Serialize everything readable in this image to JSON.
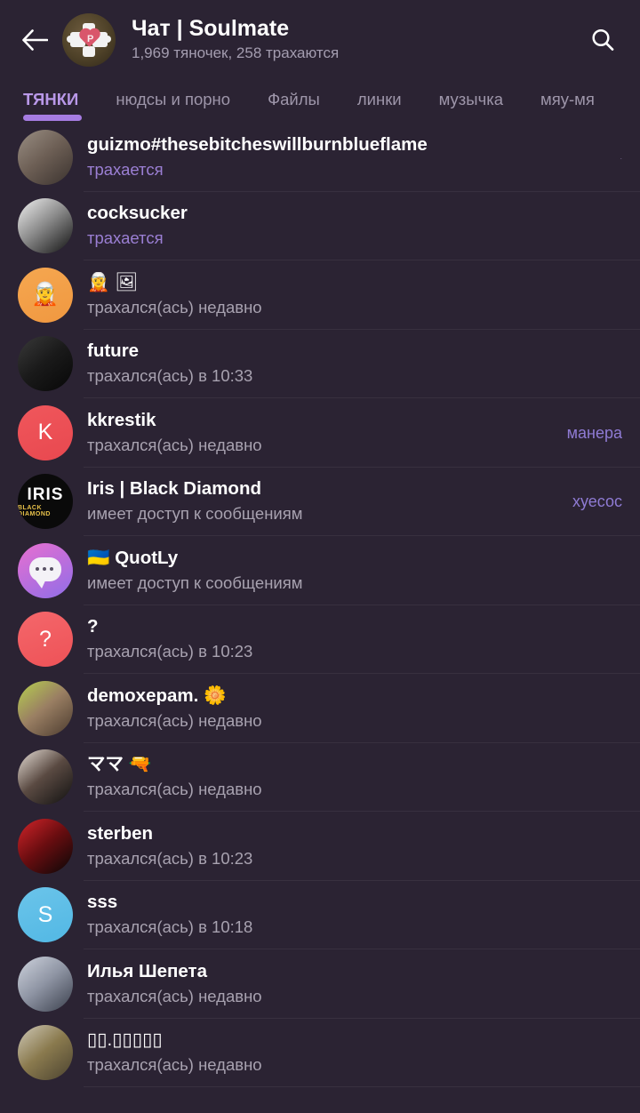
{
  "header": {
    "back_icon": "back-arrow-icon",
    "avatar_icon": "puzzle-heart-avatar",
    "avatar_letter": "P",
    "title": "Чат | Soulmate",
    "subtitle": "1,969 тяночек, 258 трахаются",
    "search_icon": "search-icon"
  },
  "tabs": {
    "items": [
      {
        "label": "ТЯНКИ",
        "active": true
      },
      {
        "label": "нюдсы и порно",
        "active": false
      },
      {
        "label": "Файлы",
        "active": false
      },
      {
        "label": "линки",
        "active": false
      },
      {
        "label": "музычка",
        "active": false
      },
      {
        "label": "мяу-мя",
        "active": false
      }
    ]
  },
  "members": [
    {
      "name": "guizmo#thesebitcheswillburnblueflame",
      "status": "трахается",
      "online": true,
      "badge": ".",
      "badge_tiny": true,
      "avatar_type": "photo",
      "avatar_colors": [
        "#9a8f84",
        "#6d5f55",
        "#3a322e"
      ],
      "avatar_label": ""
    },
    {
      "name": "cocksucker",
      "status": "трахается",
      "online": true,
      "badge": "",
      "avatar_type": "photo",
      "avatar_colors": [
        "#f2f2f2",
        "#8a8a8a",
        "#101010"
      ],
      "avatar_label": ""
    },
    {
      "name": "🧝 🖼",
      "status": "трахался(ась) недавно",
      "online": false,
      "badge": "",
      "avatar_type": "solid",
      "avatar_colors": [
        "#f5a750",
        "#f09840"
      ],
      "avatar_label": "🧝"
    },
    {
      "name": "future",
      "status": "трахался(ась) в 10:33",
      "online": false,
      "badge": "",
      "avatar_type": "photo",
      "avatar_colors": [
        "#3a3a3a",
        "#1a1a1a",
        "#070707"
      ],
      "avatar_label": ""
    },
    {
      "name": "kkrestik",
      "status": "трахался(ась) недавно",
      "online": false,
      "badge": "манера",
      "avatar_type": "solid",
      "avatar_colors": [
        "#f0575c",
        "#e8484f"
      ],
      "avatar_label": "K"
    },
    {
      "name": "Iris | Black Diamond",
      "status": "имеет доступ к сообщениям",
      "online": false,
      "badge": "хуесос",
      "avatar_type": "iris",
      "avatar_colors": [
        "#0a0a0a",
        "#0a0a0a"
      ],
      "avatar_label": "IRIS",
      "avatar_sublabel": "BLACK DIAMOND"
    },
    {
      "name": "🇺🇦 QuotLy",
      "status": "имеет доступ к сообщениям",
      "online": false,
      "badge": "",
      "avatar_type": "bubble",
      "avatar_colors": [
        "#e86fd0",
        "#8f6ee8"
      ],
      "avatar_label": ""
    },
    {
      "name": "?",
      "status": "трахался(ась) в 10:23",
      "online": false,
      "badge": "",
      "avatar_type": "solid",
      "avatar_colors": [
        "#f4676b",
        "#ee5257"
      ],
      "avatar_label": "?"
    },
    {
      "name": "demoxepam. 🌼",
      "status": "трахался(ась) недавно",
      "online": false,
      "badge": "",
      "avatar_type": "photo",
      "avatar_colors": [
        "#b7d14e",
        "#9a7f63",
        "#4a3a2e"
      ],
      "avatar_label": ""
    },
    {
      "name": "ママ 🔫",
      "status": "трахался(ась) недавно",
      "online": false,
      "badge": "",
      "avatar_type": "photo",
      "avatar_colors": [
        "#e8e0d8",
        "#5a4a42",
        "#101010"
      ],
      "avatar_label": ""
    },
    {
      "name": "sterben",
      "status": "трахался(ась) в 10:23",
      "online": false,
      "badge": "",
      "avatar_type": "photo",
      "avatar_colors": [
        "#d4252a",
        "#6a0d10",
        "#070707"
      ],
      "avatar_label": ""
    },
    {
      "name": "sss",
      "status": "трахался(ась) в 10:18",
      "online": false,
      "badge": "",
      "avatar_type": "solid",
      "avatar_colors": [
        "#6bc4ea",
        "#52b8e4"
      ],
      "avatar_label": "S"
    },
    {
      "name": "Илья Шепета",
      "status": "трахался(ась) недавно",
      "online": false,
      "badge": "",
      "avatar_type": "photo",
      "avatar_colors": [
        "#cfd4de",
        "#8f95a4",
        "#3a3f4c"
      ],
      "avatar_label": ""
    },
    {
      "name": "▯▯.▯▯▯▯▯",
      "status": "трахался(ась) недавно",
      "online": false,
      "badge": "",
      "avatar_type": "photo",
      "avatar_colors": [
        "#cfc9b8",
        "#8a7a4e",
        "#4a4230"
      ],
      "avatar_label": ""
    }
  ],
  "colors": {
    "background": "#2b2333",
    "accent_purple": "#a67ce2",
    "online_status": "#9b7fd4",
    "offline_status": "#a8a2b0",
    "badge": "#8f7bd4",
    "divider": "#38303f",
    "title_text": "#ffffff",
    "subtitle_text": "#a49db0"
  }
}
